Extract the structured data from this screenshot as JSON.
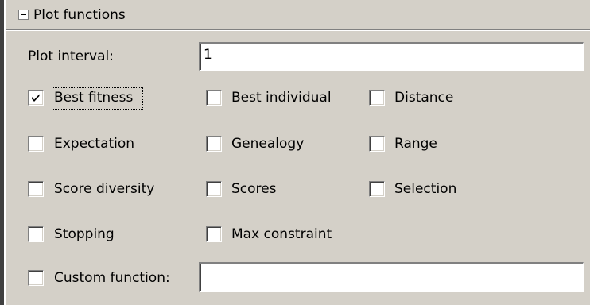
{
  "section": {
    "title": "Plot functions",
    "icon": "collapse-minus-icon"
  },
  "plot_interval": {
    "label": "Plot interval:",
    "value": "1"
  },
  "checkboxes": [
    {
      "label": "Best fitness",
      "checked": true
    },
    {
      "label": "Best individual",
      "checked": false
    },
    {
      "label": "Distance",
      "checked": false
    },
    {
      "label": "Expectation",
      "checked": false
    },
    {
      "label": "Genealogy",
      "checked": false
    },
    {
      "label": "Range",
      "checked": false
    },
    {
      "label": "Score diversity",
      "checked": false
    },
    {
      "label": "Scores",
      "checked": false
    },
    {
      "label": "Selection",
      "checked": false
    },
    {
      "label": "Stopping",
      "checked": false
    },
    {
      "label": "Max constraint",
      "checked": false
    }
  ],
  "custom_function": {
    "label": "Custom function:",
    "checked": false,
    "value": ""
  },
  "colors": {
    "panel_bg": "#d4d0c8",
    "input_bg": "#ffffff"
  }
}
